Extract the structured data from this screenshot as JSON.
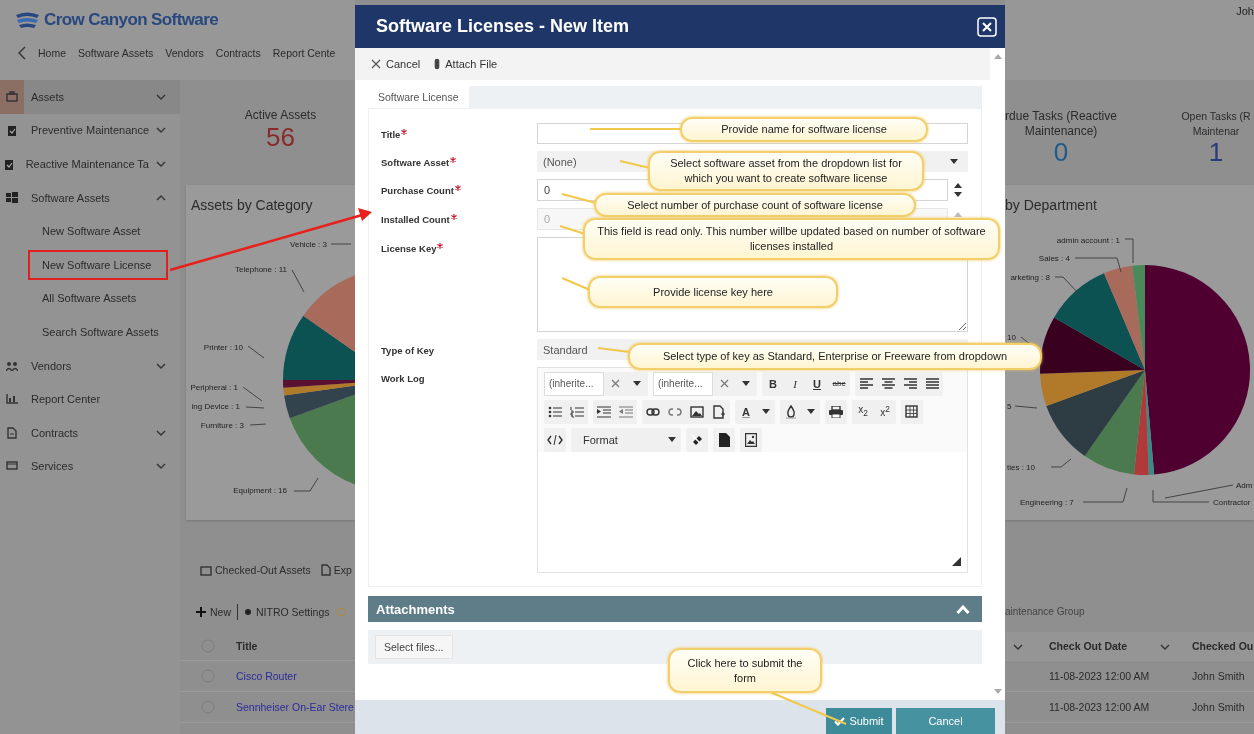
{
  "app": {
    "logo": "Crow Canyon Software",
    "user": "Joh",
    "nav": [
      "Home",
      "Software Assets",
      "Vendors",
      "Contracts",
      "Report Cente"
    ]
  },
  "sidebar": {
    "items": [
      {
        "label": "Assets",
        "kind": "group",
        "selected": true,
        "expanded": false
      },
      {
        "label": "Preventive Maintenance",
        "kind": "group",
        "selected": false,
        "expanded": false
      },
      {
        "label": "Reactive Maintenance Ta",
        "kind": "group",
        "selected": false,
        "expanded": false
      },
      {
        "label": "Software Assets",
        "kind": "group",
        "selected": false,
        "expanded": true,
        "children": [
          {
            "label": "New Software Asset",
            "highlighted": false
          },
          {
            "label": "New Software License",
            "highlighted": true
          },
          {
            "label": "All Software Assets",
            "highlighted": false
          },
          {
            "label": "Search Software Assets",
            "highlighted": false
          }
        ]
      },
      {
        "label": "Vendors",
        "kind": "group",
        "selected": false,
        "expanded": false
      },
      {
        "label": "Report Center",
        "kind": "link",
        "selected": false
      },
      {
        "label": "Contracts",
        "kind": "group",
        "selected": false,
        "expanded": false
      },
      {
        "label": "Services",
        "kind": "group",
        "selected": false,
        "expanded": false
      }
    ]
  },
  "dashboard": {
    "stats_left": [
      {
        "label_lines": [
          "Active Assets"
        ],
        "value": "56",
        "color": "#8a2a2a"
      }
    ],
    "stats_right": [
      {
        "label_lines": [
          "rdue Tasks (Reactive",
          "Maintenance)"
        ],
        "value": "0",
        "color": "#1f5a8a"
      },
      {
        "label_lines": [
          "Open Tasks (R",
          "Maintenar"
        ],
        "value": "1",
        "color": "#2a3a7a"
      }
    ],
    "category_chart": {
      "title": "Assets by Category",
      "labels": [
        "Vehicle : 3",
        "Telephone : 11",
        "Printer : 10",
        "Peripheral : 1",
        "ing Device : 1",
        "Furniture : 3",
        "Equipment : 16"
      ]
    },
    "department_chart": {
      "title": "by Department",
      "labels": [
        "admin account : 1",
        "Sales : 4",
        "arketing : 8",
        "10",
        "5",
        "ties : 10",
        "Engineering : 7",
        "Adm",
        "Contractor"
      ]
    },
    "assets_panel": {
      "tabs": [
        "Checked-Out Assets",
        "Exp"
      ],
      "new_button": "New",
      "settings": "NITRO Settings",
      "columns": [
        "Title"
      ],
      "rows": [
        {
          "title": "Cisco Router",
          "selected": false
        },
        {
          "title": "Sennheiser On-Ear Stere",
          "selected": false
        }
      ]
    },
    "checkout_panel": {
      "group_label": "aintenance Group",
      "columns": [
        "Check Out Date",
        "Checked Ou"
      ],
      "rows": [
        {
          "cells": [
            "11-08-2023 12:00 AM",
            "John Smith"
          ]
        },
        {
          "cells": [
            "11-08-2023 12:00 AM",
            "John Smith"
          ]
        }
      ]
    }
  },
  "modal": {
    "title": "Software Licenses - New Item",
    "toolbar": [
      "Cancel",
      "Attach File"
    ],
    "tabs": [
      {
        "label": "Software License",
        "selected": true
      }
    ],
    "fields": [
      {
        "label": "Title",
        "required": true,
        "kind": "text",
        "disabled": false
      },
      {
        "label": "Software Asset",
        "required": true,
        "kind": "select",
        "value": "(None)",
        "disabled": false
      },
      {
        "label": "Purchase Count",
        "required": true,
        "kind": "number",
        "value": "0",
        "disabled": false
      },
      {
        "label": "Installed Count",
        "required": true,
        "kind": "number",
        "value": "0",
        "disabled": true
      },
      {
        "label": "License Key",
        "required": true,
        "kind": "textarea",
        "disabled": false
      },
      {
        "label": "Type of Key",
        "required": false,
        "kind": "select",
        "value": "Standard",
        "disabled": false
      },
      {
        "label": "Work Log",
        "required": false,
        "kind": "editor",
        "disabled": false
      }
    ],
    "editor": {
      "font_name": "(inherite...",
      "font_size": "(inherite...",
      "style_buttons": [
        "B",
        "I",
        "U",
        "abc"
      ],
      "font_color": "A",
      "subscript": "x$_{2}$",
      "superscript": "x$^{2}$",
      "format": "Format"
    },
    "attachments": {
      "title": "Attachments",
      "expanded": true,
      "button": "Select files..."
    },
    "footer": [
      "Submit",
      "Cancel"
    ]
  },
  "callouts": [
    {
      "text": "Provide name for software license"
    },
    {
      "text": "Select software asset from the  dropdown list for which you want to create software license"
    },
    {
      "text": "Select number of purchase count of software license"
    },
    {
      "text": "This field is read only. This number willbe updated based on number of software licenses installed"
    },
    {
      "text": "Provide license key here"
    },
    {
      "text": "Select type of key as Standard, Enterprise or Freeware from dropdown"
    },
    {
      "text": "Click here to submit the form"
    }
  ]
}
